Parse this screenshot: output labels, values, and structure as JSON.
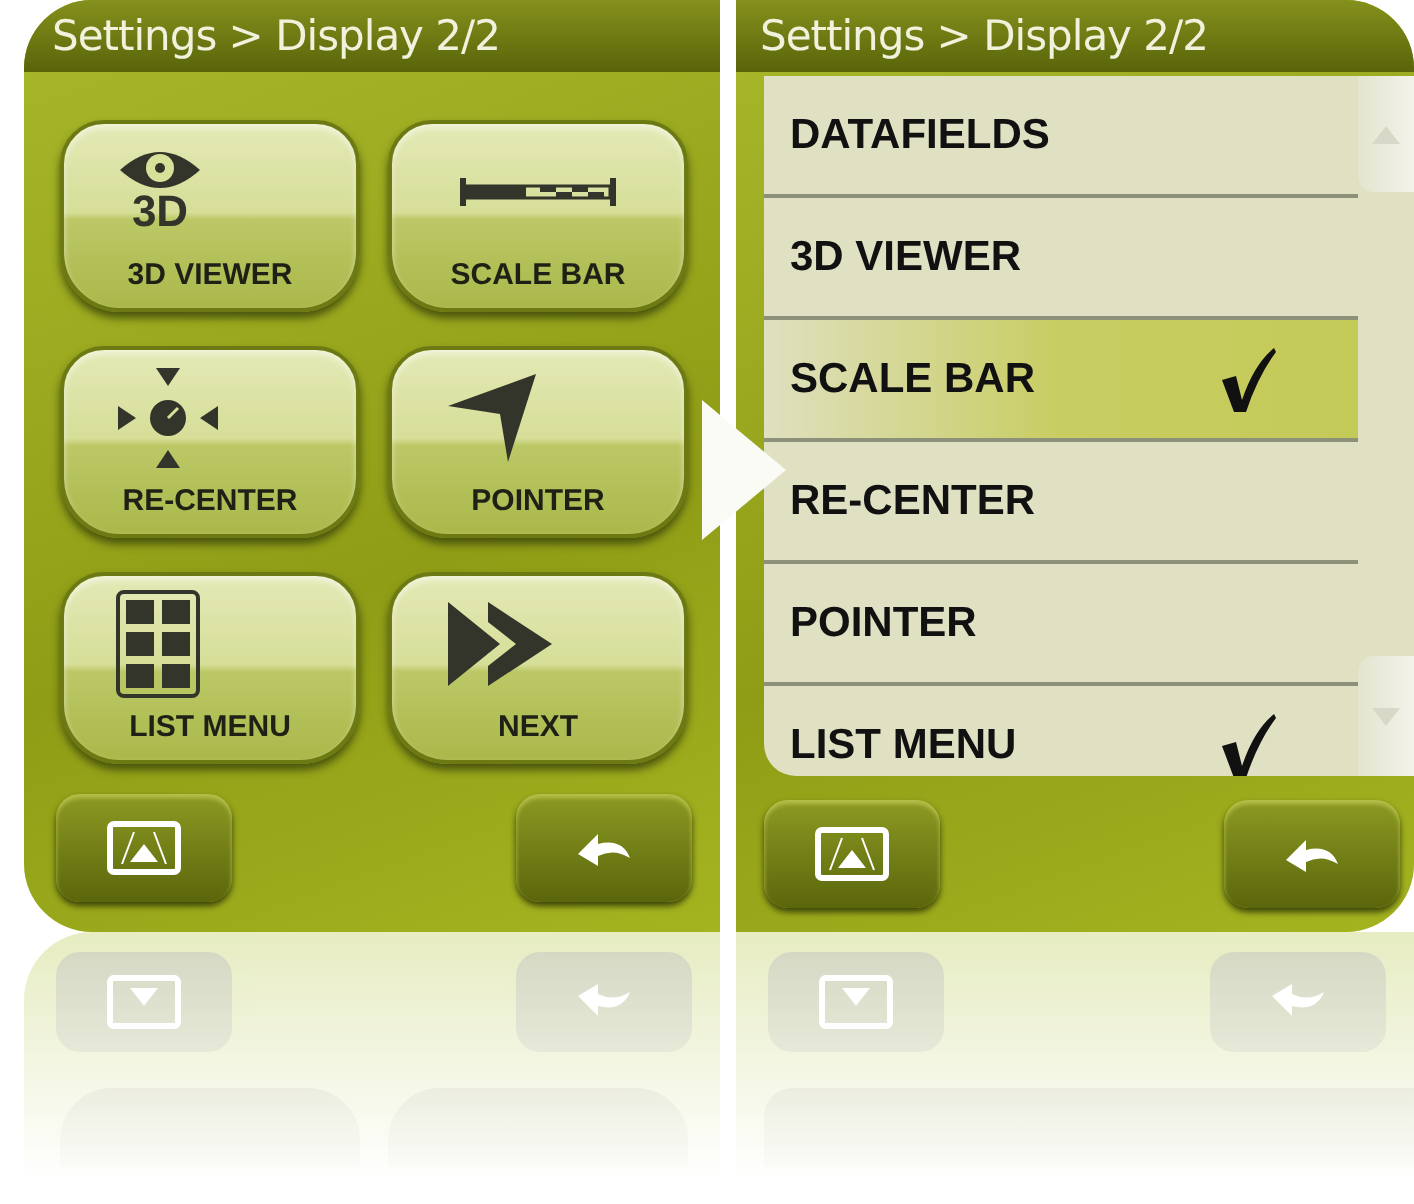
{
  "screens": [
    {
      "title": "Settings > Display 2/2",
      "kind": "tiles",
      "tiles": [
        {
          "label": "3D VIEWER",
          "kind": "eye3d",
          "icon_text": "3D"
        },
        {
          "label": "SCALE BAR",
          "kind": "scale"
        },
        {
          "label": "RE-CENTER",
          "kind": "recenter"
        },
        {
          "label": "POINTER",
          "kind": "pointer"
        },
        {
          "label": "LIST MENU",
          "kind": "grid"
        },
        {
          "label": "NEXT",
          "kind": "next"
        }
      ],
      "buttons": [
        {
          "kind": "map"
        },
        {
          "kind": "back"
        }
      ]
    },
    {
      "title": "Settings > Display 2/2",
      "kind": "list",
      "items": [
        {
          "label": "DATAFIELDS",
          "checked": false,
          "selected": false
        },
        {
          "label": "3D VIEWER",
          "checked": false,
          "selected": false
        },
        {
          "label": "SCALE BAR",
          "checked": true,
          "selected": true
        },
        {
          "label": "RE-CENTER",
          "checked": false,
          "selected": false
        },
        {
          "label": "POINTER",
          "checked": false,
          "selected": false
        },
        {
          "label": "LIST MENU",
          "checked": true,
          "selected": false
        }
      ],
      "buttons": [
        {
          "kind": "map"
        },
        {
          "kind": "back"
        }
      ]
    }
  ]
}
